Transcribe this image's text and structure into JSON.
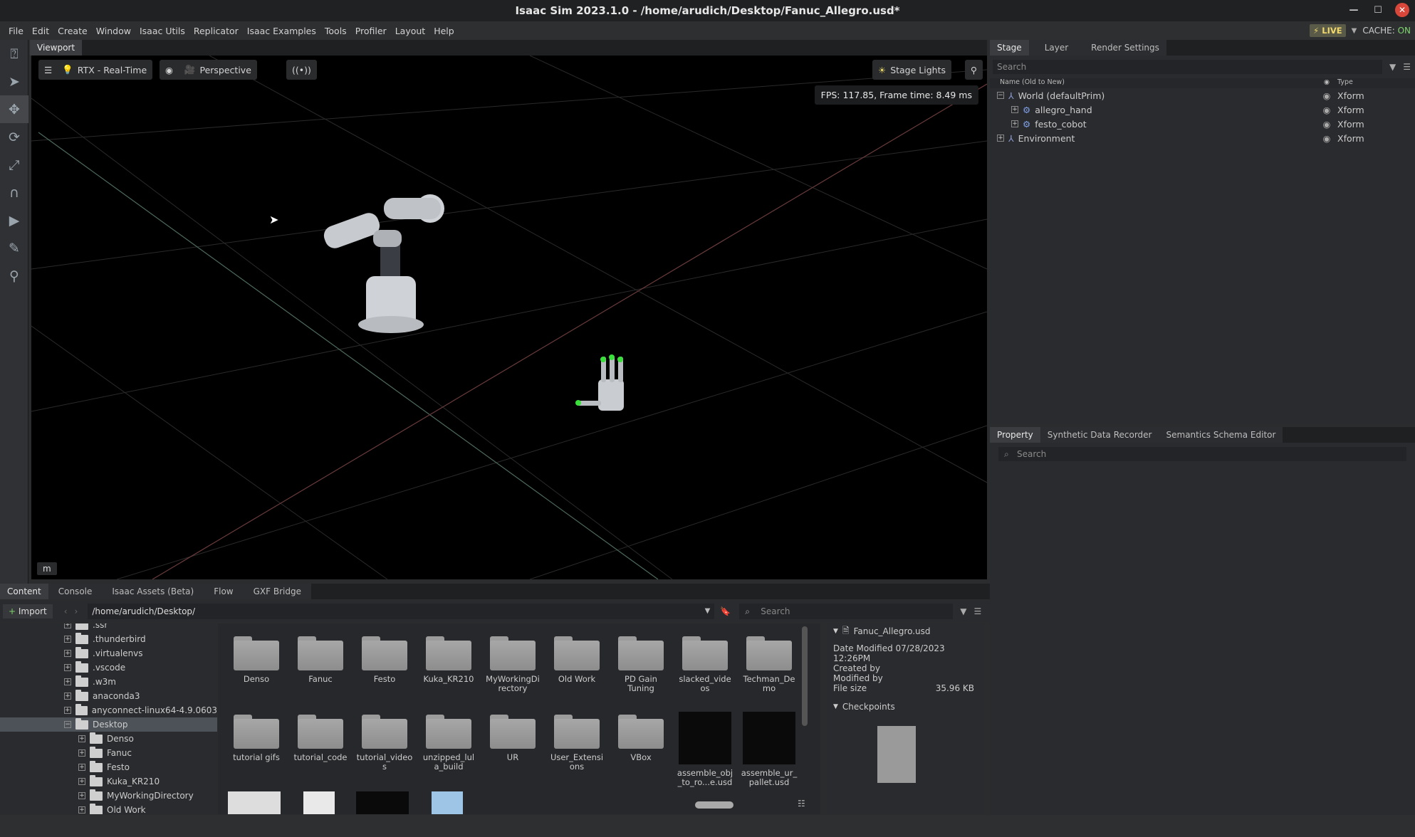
{
  "window": {
    "title": "Isaac Sim 2023.1.0 - /home/arudich/Desktop/Fanuc_Allegro.usd*"
  },
  "menu": [
    "File",
    "Edit",
    "Create",
    "Window",
    "Isaac Utils",
    "Replicator",
    "Isaac Examples",
    "Tools",
    "Profiler",
    "Layout",
    "Help"
  ],
  "status": {
    "live": "LIVE",
    "cache_label": "CACHE:",
    "cache_value": "ON"
  },
  "viewport": {
    "tab": "Viewport",
    "renderer": "RTX - Real-Time",
    "camera": "Perspective",
    "lights": "Stage Lights",
    "fps": "FPS: 117.85, Frame time: 8.49 ms",
    "unit": "m"
  },
  "stage": {
    "tabs": [
      "Stage",
      "Layer",
      "Render Settings"
    ],
    "search_placeholder": "Search",
    "col_name": "Name (Old to New)",
    "col_type": "Type",
    "rows": [
      {
        "name": "World (defaultPrim)",
        "type": "Xform",
        "expander": "−"
      },
      {
        "name": "allegro_hand",
        "type": "Xform",
        "expander": "+"
      },
      {
        "name": "festo_cobot",
        "type": "Xform",
        "expander": "+"
      },
      {
        "name": "Environment",
        "type": "Xform",
        "expander": "+"
      }
    ]
  },
  "property": {
    "tabs": [
      "Property",
      "Synthetic Data Recorder",
      "Semantics Schema Editor"
    ],
    "search_placeholder": "Search"
  },
  "content": {
    "tabs": [
      "Content",
      "Console",
      "Isaac Assets (Beta)",
      "Flow",
      "GXF Bridge"
    ],
    "import_label": "Import",
    "path": "/home/arudich/Desktop/",
    "search_placeholder": "Search",
    "tree": [
      {
        "label": ".ssr",
        "level": 1
      },
      {
        "label": ".thunderbird",
        "level": 1
      },
      {
        "label": ".virtualenvs",
        "level": 1
      },
      {
        "label": ".vscode",
        "level": 1
      },
      {
        "label": ".w3m",
        "level": 1
      },
      {
        "label": "anaconda3",
        "level": 1
      },
      {
        "label": "anyconnect-linux64-4.9.0603",
        "level": 1
      },
      {
        "label": "Desktop",
        "level": 1
      },
      {
        "label": "Denso",
        "level": 2
      },
      {
        "label": "Fanuc",
        "level": 2
      },
      {
        "label": "Festo",
        "level": 2
      },
      {
        "label": "Kuka_KR210",
        "level": 2
      },
      {
        "label": "MyWorkingDirectory",
        "level": 2
      },
      {
        "label": "Old Work",
        "level": 2
      }
    ],
    "items": [
      {
        "label": "Denso"
      },
      {
        "label": "Fanuc"
      },
      {
        "label": "Festo"
      },
      {
        "label": "Kuka_KR210"
      },
      {
        "label": "MyWorkingDi rectory"
      },
      {
        "label": "Old Work"
      },
      {
        "label": "PD Gain Tuning"
      },
      {
        "label": "slacked_vide os"
      },
      {
        "label": "Techman_De mo"
      },
      {
        "label": "tutorial gifs"
      },
      {
        "label": "tutorial_code"
      },
      {
        "label": "tutorial_video s"
      },
      {
        "label": "unzipped_lul a_build"
      },
      {
        "label": "UR"
      },
      {
        "label": "User_Extensi ons"
      },
      {
        "label": "VBox"
      },
      {
        "label": "assemble_obj _to_ro...e.usd"
      },
      {
        "label": "assemble_ur_ pallet.usd"
      }
    ],
    "selected": {
      "name": "Fanuc_Allegro.usd",
      "date_label": "Date Modified",
      "date": "07/28/2023 12:26PM",
      "created": "Created by",
      "modified": "Modified by",
      "size_label": "File size",
      "size": "35.96 KB",
      "checkpoints": "Checkpoints"
    }
  }
}
